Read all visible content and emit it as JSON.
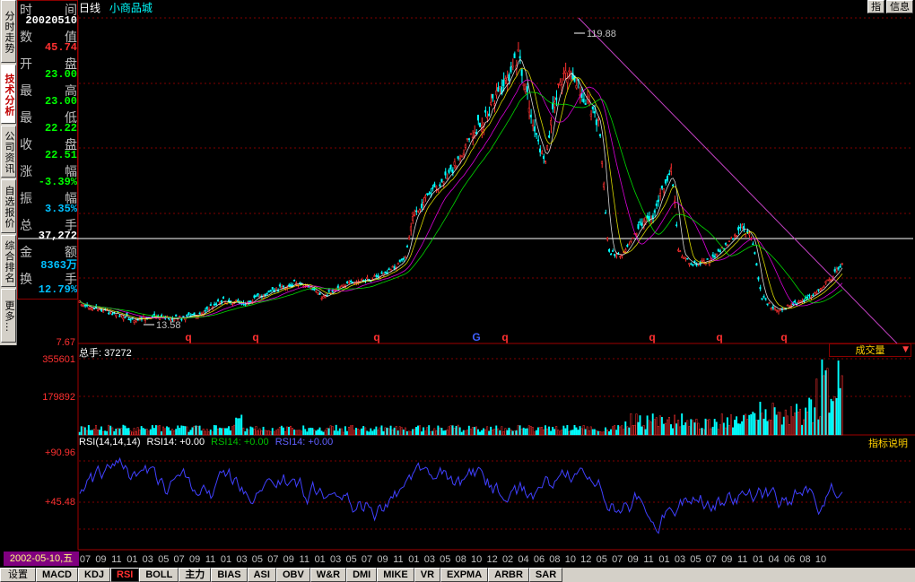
{
  "left_tabs": [
    {
      "label": "分时走势",
      "active": false
    },
    {
      "label": "技术分析",
      "active": true
    },
    {
      "label": "公司资讯",
      "active": false
    },
    {
      "label": "自选报价",
      "active": false
    },
    {
      "label": "综合排名",
      "active": false
    },
    {
      "label": "更多…",
      "active": false
    }
  ],
  "info": {
    "rows": [
      {
        "l1": "时",
        "l2": "间",
        "value": "20020510",
        "color": "#ffffff"
      },
      {
        "l1": "数",
        "l2": "值",
        "value": "45.74",
        "color": "#ff3030"
      },
      {
        "l1": "开",
        "l2": "盘",
        "value": "23.00",
        "color": "#00ff00"
      },
      {
        "l1": "最",
        "l2": "高",
        "value": "23.00",
        "color": "#00ff00"
      },
      {
        "l1": "最",
        "l2": "低",
        "value": "22.22",
        "color": "#00ff00"
      },
      {
        "l1": "收",
        "l2": "盘",
        "value": "22.51",
        "color": "#00ff00"
      },
      {
        "l1": "涨",
        "l2": "幅",
        "value": "-3.39%",
        "color": "#00ff00"
      },
      {
        "l1": "振",
        "l2": "幅",
        "value": "3.35%",
        "color": "#00c0ff"
      },
      {
        "l1": "总",
        "l2": "手",
        "value": "37,272",
        "color": "#ffffff"
      },
      {
        "l1": "金",
        "l2": "额",
        "value": "8363万",
        "color": "#00c0ff"
      },
      {
        "l1": "换",
        "l2": "手",
        "value": "12.79%",
        "color": "#00c0ff"
      }
    ]
  },
  "header": {
    "period": "日线",
    "stock_name": "小商品城"
  },
  "top_buttons": {
    "pointer": "指",
    "info": "信息"
  },
  "main_chart": {
    "y_ticks": [
      {
        "label": "7.67"
      }
    ],
    "max_label": "119.88",
    "min_label": "13.58",
    "markers": [
      {
        "t": "q",
        "color": "#ff3030"
      },
      {
        "t": "q",
        "color": "#ff3030"
      },
      {
        "t": "q",
        "color": "#ff3030"
      },
      {
        "t": "G",
        "color": "#4060ff"
      },
      {
        "t": "q",
        "color": "#ff3030"
      },
      {
        "t": "q",
        "color": "#ff3030"
      },
      {
        "t": "q",
        "color": "#ff3030"
      },
      {
        "t": "q",
        "color": "#ff3030"
      }
    ]
  },
  "volume": {
    "label": "总手: 37272",
    "ticks": [
      "355601",
      "179892"
    ],
    "selector": "成交量",
    "arrow": "▼"
  },
  "rsi": {
    "name": "RSI(14,14,14)",
    "series": [
      {
        "label": "RSI14: +0.00",
        "color": "#ffffff"
      },
      {
        "label": "RSI14: +0.00",
        "color": "#00c000"
      },
      {
        "label": "RSI14: +0.00",
        "color": "#6060ff"
      }
    ],
    "ticks": [
      "+90.96",
      "+45.48"
    ],
    "help_button": "指标说明"
  },
  "x_axis_labels": [
    "07",
    "09",
    "11",
    "01",
    "03",
    "05",
    "07",
    "09",
    "11",
    "01",
    "03",
    "05",
    "07",
    "09",
    "11",
    "01",
    "03",
    "05",
    "07",
    "09",
    "11",
    "01",
    "03",
    "05",
    "08",
    "10",
    "12",
    "02",
    "04",
    "06",
    "08",
    "10",
    "12",
    "05",
    "07",
    "09",
    "11",
    "01",
    "03",
    "05",
    "07",
    "09",
    "11",
    "01",
    "04",
    "06",
    "08",
    "10"
  ],
  "current_date": "2002-05-10,五",
  "bottom_tabs": [
    {
      "label": "设置",
      "kind": "setting"
    },
    {
      "label": "MACD"
    },
    {
      "label": "KDJ"
    },
    {
      "label": "RSI",
      "active": true
    },
    {
      "label": "BOLL"
    },
    {
      "label": "主力"
    },
    {
      "label": "BIAS"
    },
    {
      "label": "ASI"
    },
    {
      "label": "OBV"
    },
    {
      "label": "W&R"
    },
    {
      "label": "DMI"
    },
    {
      "label": "MIKE"
    },
    {
      "label": "VR"
    },
    {
      "label": "EXPMA"
    },
    {
      "label": "ARBR"
    },
    {
      "label": "SAR"
    }
  ],
  "colors": {
    "up": "#ff3030",
    "down": "#00ffff",
    "grid": "#800000",
    "trend": "#c040c0",
    "rsi": "#4040ff"
  }
}
